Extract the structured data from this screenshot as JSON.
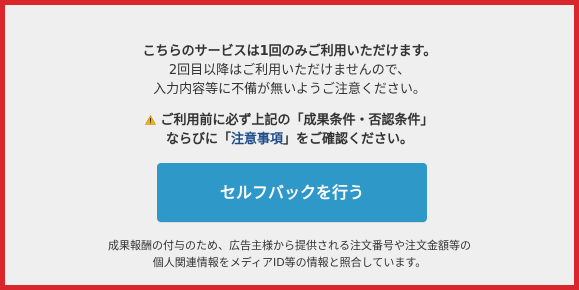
{
  "notice": {
    "line1": "こちらのサービスは1回のみご利用いただけます。",
    "line2": "2回目以降はご利用いただけませんので、",
    "line3": "入力内容等に不備が無いようご注意ください。"
  },
  "warning": {
    "icon": "warning-icon",
    "line1": "ご利用前に必ず上記の「成果条件・否認条件」",
    "line2_before": "ならびに「",
    "line2_link": "注意事項",
    "line2_after": "」をご確認ください。"
  },
  "cta": {
    "label": "セルフバックを行う"
  },
  "footnote": {
    "line1": "成果報酬の付与のため、広告主様から提供される注文番号や注文金額等の",
    "line2": "個人関連情報をメディアID等の情報と照合しています。"
  },
  "colors": {
    "border": "#d9262c",
    "background": "#efefef",
    "button": "#2e98c8",
    "link": "#1f4f8a",
    "warning": "#f2b01e"
  }
}
